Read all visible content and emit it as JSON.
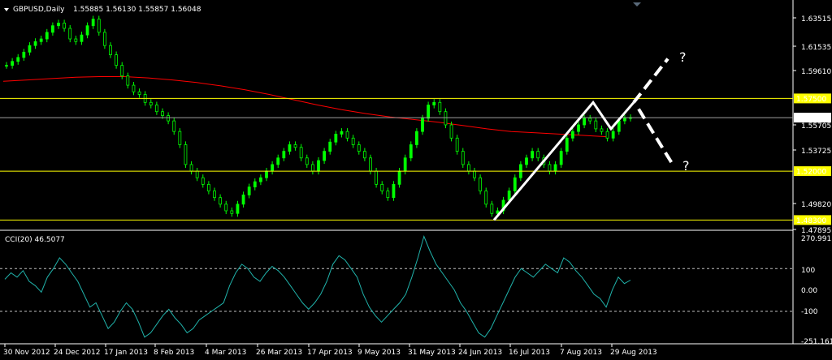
{
  "header": {
    "symbol": "GBPUSD,Daily",
    "ohlc": "1.55885 1.56130 1.55857 1.56048"
  },
  "indicator": {
    "label": "CCI(20) 46.5077",
    "axis_labels": [
      "270.9917",
      "100",
      "0.00",
      "-100",
      "-251.1611"
    ]
  },
  "annotations": {
    "question_marks": [
      "?",
      "?"
    ]
  },
  "colors": {
    "background": "#000000",
    "candle": "#00ff00",
    "ma": "#ff0000",
    "level": "#ffff00",
    "current": "#a0a0a0",
    "cci": "#20b2aa",
    "pattern": "#ffffff"
  },
  "chart_data": [
    {
      "type": "line",
      "subtype": "candlestick",
      "series_name": "GBPUSD,Daily",
      "ohlc_last": {
        "open": 1.55885,
        "high": 1.5613,
        "low": 1.55857,
        "close": 1.56048
      },
      "x_tick_labels": [
        "30 Nov 2012",
        "24 Dec 2012",
        "17 Jan 2013",
        "8 Feb 2013",
        "4 Mar 2013",
        "26 Mar 2013",
        "17 Apr 2013",
        "9 May 2013",
        "31 May 2013",
        "24 Jun 2013",
        "16 Jul 2013",
        "7 Aug 2013",
        "29 Aug 2013"
      ],
      "y_tick_labels": [
        "1.63515",
        "1.61535",
        "1.59610",
        "1.57500",
        "1.56048",
        "1.55705",
        "1.53725",
        "1.52000",
        "1.49820",
        "1.48300",
        "1.47895"
      ],
      "ylim": [
        1.4765,
        1.647
      ],
      "price_close": [
        1.6,
        1.603,
        1.606,
        1.61,
        1.615,
        1.618,
        1.62,
        1.625,
        1.63,
        1.632,
        1.628,
        1.62,
        1.618,
        1.623,
        1.63,
        1.635,
        1.625,
        1.615,
        1.608,
        1.6,
        1.592,
        1.585,
        1.58,
        1.578,
        1.572,
        1.57,
        1.565,
        1.562,
        1.558,
        1.55,
        1.54,
        1.525,
        1.52,
        1.515,
        1.51,
        1.505,
        1.5,
        1.495,
        1.49,
        1.488,
        1.495,
        1.502,
        1.508,
        1.512,
        1.515,
        1.52,
        1.525,
        1.53,
        1.535,
        1.54,
        1.538,
        1.53,
        1.525,
        1.52,
        1.528,
        1.535,
        1.542,
        1.548,
        1.55,
        1.545,
        1.54,
        1.535,
        1.53,
        1.52,
        1.51,
        1.505,
        1.5,
        1.51,
        1.52,
        1.53,
        1.54,
        1.55,
        1.56,
        1.57,
        1.572,
        1.565,
        1.555,
        1.545,
        1.535,
        1.525,
        1.52,
        1.515,
        1.505,
        1.495,
        1.488,
        1.49,
        1.498,
        1.505,
        1.515,
        1.525,
        1.53,
        1.535,
        1.53,
        1.525,
        1.52,
        1.525,
        1.535,
        1.545,
        1.55,
        1.555,
        1.56,
        1.558,
        1.552,
        1.55,
        1.545,
        1.55,
        1.558,
        1.56,
        1.5605
      ],
      "moving_average": [
        1.588,
        1.589,
        1.59,
        1.591,
        1.5915,
        1.5915,
        1.5905,
        1.589,
        1.587,
        1.5845,
        1.5815,
        1.578,
        1.574,
        1.57,
        1.5665,
        1.5635,
        1.561,
        1.559,
        1.557,
        1.5545,
        1.552,
        1.55,
        1.549,
        1.548,
        1.547,
        1.546
      ],
      "horizontal_levels": [
        1.575,
        1.56048,
        1.52,
        1.483
      ],
      "level_labels": [
        "1.57500",
        "1.56048",
        "1.52000",
        "1.48300"
      ],
      "pattern_line": [
        1.483,
        1.572,
        1.552,
        1.572
      ],
      "projection_up_target": 1.605,
      "projection_down_target": 1.525
    },
    {
      "type": "line",
      "series_name": "CCI(20)",
      "last_value": 46.5077,
      "ylim": [
        -251.1611,
        270.9917
      ],
      "reference_lines": [
        100,
        -100
      ],
      "values": [
        50,
        80,
        60,
        90,
        40,
        20,
        -10,
        60,
        100,
        150,
        120,
        80,
        40,
        -20,
        -80,
        -60,
        -120,
        -180,
        -150,
        -100,
        -60,
        -90,
        -150,
        -220,
        -200,
        -160,
        -120,
        -90,
        -130,
        -160,
        -200,
        -180,
        -140,
        -120,
        -100,
        -80,
        -60,
        20,
        80,
        120,
        100,
        60,
        40,
        80,
        110,
        90,
        60,
        20,
        -20,
        -60,
        -90,
        -60,
        -20,
        40,
        120,
        160,
        140,
        100,
        60,
        -20,
        -80,
        -120,
        -150,
        -120,
        -90,
        -60,
        -20,
        60,
        150,
        250,
        180,
        120,
        80,
        40,
        0,
        -60,
        -100,
        -150,
        -200,
        -220,
        -180,
        -120,
        -60,
        0,
        60,
        100,
        80,
        60,
        90,
        120,
        100,
        80,
        150,
        130,
        90,
        60,
        20,
        -20,
        -40,
        -80,
        0,
        60,
        30,
        46
      ]
    }
  ]
}
